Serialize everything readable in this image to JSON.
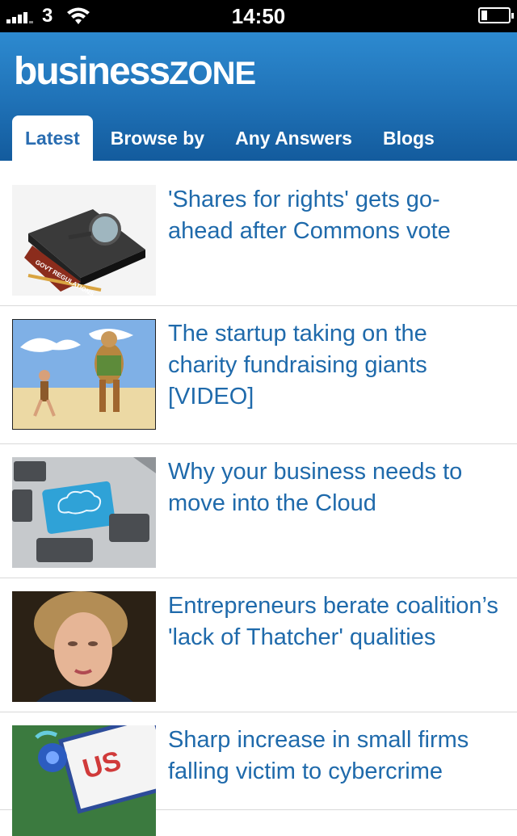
{
  "status_bar": {
    "carrier": "3",
    "time": "14:50"
  },
  "header": {
    "logo_part1": "business",
    "logo_part2": "ZONE",
    "tabs": [
      {
        "label": "Latest",
        "active": true
      },
      {
        "label": "Browse by",
        "active": false
      },
      {
        "label": "Any Answers",
        "active": false
      },
      {
        "label": "Blogs",
        "active": false
      }
    ]
  },
  "articles": [
    {
      "headline": "'Shares for rights' gets go-ahead after Commons vote",
      "image": "govt-regulations-folder-icon"
    },
    {
      "headline": "The startup taking on the charity fundraising giants [VIDEO]",
      "image": "david-goliath-illustration"
    },
    {
      "headline": "Why your business needs to move into the Cloud",
      "image": "cloud-keyboard-key"
    },
    {
      "headline": "Entrepreneurs berate coalition’s 'lack of Thatcher' qualities",
      "image": "thatcher-portrait"
    },
    {
      "headline": "Sharp increase in small firms falling victim to cybercrime",
      "image": "virus-illustration"
    }
  ],
  "colors": {
    "header_top": "#2d8ad0",
    "header_bottom": "#135b9d",
    "headline": "#1f6aab",
    "active_tab_text": "#2a6db1"
  }
}
